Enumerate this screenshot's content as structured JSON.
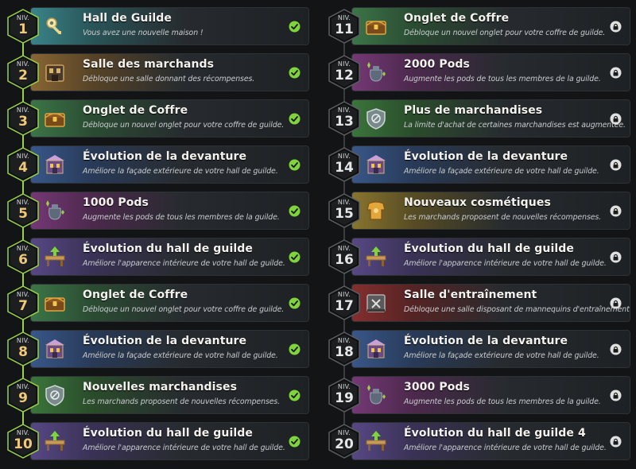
{
  "colors": {
    "unlocked_accent": "#9ad14a",
    "unlocked_number": "#f0c97a",
    "locked_number": "#e6e6e6",
    "check": "#7fd33c",
    "lock": "#e0e0e0"
  },
  "left_levels": [
    {
      "niv": "NIV.",
      "num": "1",
      "title": "Hall de Guilde",
      "desc": "Vous avez une nouvelle maison !",
      "icon": "guild-key-icon",
      "tint": "#3b8a8f",
      "state": "unlocked"
    },
    {
      "niv": "NIV.",
      "num": "2",
      "title": "Salle des marchands",
      "desc": "Débloque une salle donnant des récompenses.",
      "icon": "merchant-room-icon",
      "tint": "#8f6a35",
      "state": "unlocked"
    },
    {
      "niv": "NIV.",
      "num": "3",
      "title": "Onglet de Coffre",
      "desc": "Débloque un nouvel onglet pour votre coffre de guilde.",
      "icon": "chest-icon",
      "tint": "#3e7a4a",
      "state": "unlocked"
    },
    {
      "niv": "NIV.",
      "num": "4",
      "title": "Évolution de la devanture",
      "desc": "Améliore la façade extérieure de votre hall de guilde.",
      "icon": "storefront-icon",
      "tint": "#3a5a8f",
      "state": "unlocked"
    },
    {
      "niv": "NIV.",
      "num": "5",
      "title": "1000 Pods",
      "desc": "Augmente les pods de tous les membres de la guilde.",
      "icon": "pods-bag-icon",
      "tint": "#7a3a7a",
      "state": "unlocked"
    },
    {
      "niv": "NIV.",
      "num": "6",
      "title": "Évolution du hall de guilde",
      "desc": "Améliore l'apparence intérieure de votre hall de guilde.",
      "icon": "guild-desk-icon",
      "tint": "#5a4a8a",
      "state": "unlocked"
    },
    {
      "niv": "NIV.",
      "num": "7",
      "title": "Onglet de Coffre",
      "desc": "Débloque un nouvel onglet pour votre coffre de guilde.",
      "icon": "chest-icon",
      "tint": "#3e7a4a",
      "state": "unlocked"
    },
    {
      "niv": "NIV.",
      "num": "8",
      "title": "Évolution de la devanture",
      "desc": "Améliore la façade extérieure de votre hall de guilde.",
      "icon": "storefront-icon",
      "tint": "#3a5a8f",
      "state": "unlocked"
    },
    {
      "niv": "NIV.",
      "num": "9",
      "title": "Nouvelles marchandises",
      "desc": "Les marchands proposent de nouvelles récompenses.",
      "icon": "merchandise-shield-icon",
      "tint": "#3d7a3d",
      "state": "unlocked"
    },
    {
      "niv": "NIV.",
      "num": "10",
      "title": "Évolution du hall de guilde",
      "desc": "Améliore l'apparence intérieure de votre hall de guilde.",
      "icon": "guild-desk-icon",
      "tint": "#5a4a8a",
      "state": "unlocked"
    }
  ],
  "right_levels": [
    {
      "niv": "NIV.",
      "num": "11",
      "title": "Onglet de Coffre",
      "desc": "Débloque un nouvel onglet pour votre coffre de guilde.",
      "icon": "chest-icon",
      "tint": "#3e7a4a",
      "state": "locked"
    },
    {
      "niv": "NIV.",
      "num": "12",
      "title": "2000 Pods",
      "desc": "Augmente les pods de tous les membres de la guilde.",
      "icon": "pods-bag-icon",
      "tint": "#7a3a7a",
      "state": "locked"
    },
    {
      "niv": "NIV.",
      "num": "13",
      "title": "Plus de marchandises",
      "desc": "La limite d'achat de certaines marchandises est augmentée.",
      "icon": "merchandise-shield-icon",
      "tint": "#3d7a3d",
      "state": "locked"
    },
    {
      "niv": "NIV.",
      "num": "14",
      "title": "Évolution de la devanture",
      "desc": "Améliore la façade extérieure de votre hall de guilde.",
      "icon": "storefront-icon",
      "tint": "#3a5a8f",
      "state": "locked"
    },
    {
      "niv": "NIV.",
      "num": "15",
      "title": "Nouveaux cosmétiques",
      "desc": "Les marchands proposent de nouvelles récompenses.",
      "icon": "cosmetic-armor-icon",
      "tint": "#8f7a30",
      "state": "locked"
    },
    {
      "niv": "NIV.",
      "num": "16",
      "title": "Évolution du hall de guilde",
      "desc": "Améliore l'apparence intérieure de votre hall de guilde.",
      "icon": "guild-desk-icon",
      "tint": "#5a4a8a",
      "state": "locked"
    },
    {
      "niv": "NIV.",
      "num": "17",
      "title": "Salle d'entraînement",
      "desc": "Débloque une salle disposant de mannequins d'entraînement.",
      "icon": "training-room-icon",
      "tint": "#8a3030",
      "state": "locked"
    },
    {
      "niv": "NIV.",
      "num": "18",
      "title": "Évolution de la devanture",
      "desc": "Améliore la façade extérieure de votre hall de guilde.",
      "icon": "storefront-icon",
      "tint": "#3a5a8f",
      "state": "locked"
    },
    {
      "niv": "NIV.",
      "num": "19",
      "title": "3000 Pods",
      "desc": "Augmente les pods de tous les membres de la guilde.",
      "icon": "pods-bag-icon",
      "tint": "#7a3a7a",
      "state": "locked"
    },
    {
      "niv": "NIV.",
      "num": "20",
      "title": "Évolution du hall de guilde 4",
      "desc": "Améliore l'apparence intérieure de votre hall de guilde.",
      "icon": "guild-desk-icon",
      "tint": "#5a4a8a",
      "state": "locked"
    }
  ]
}
